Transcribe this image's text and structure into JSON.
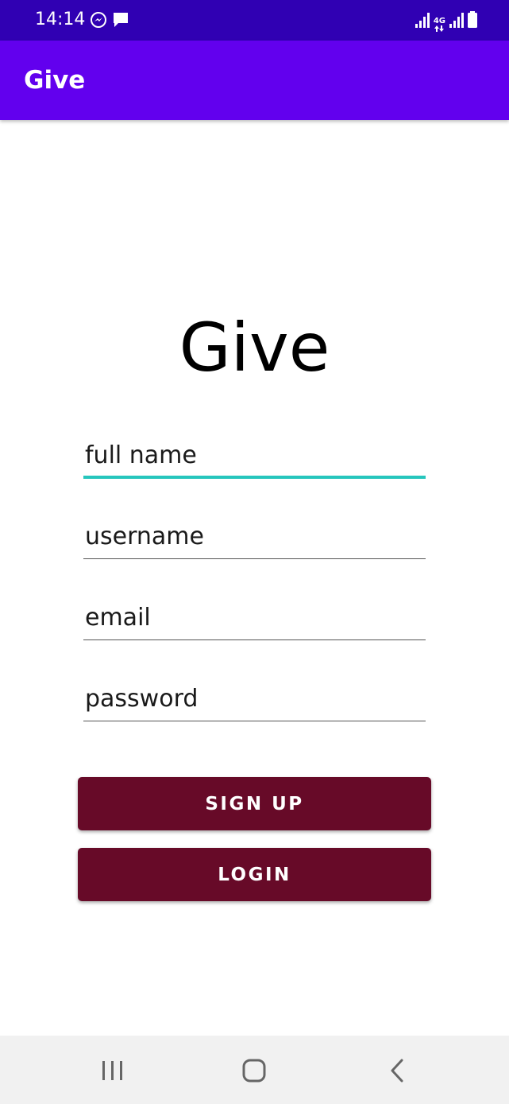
{
  "status_bar": {
    "time": "14:14",
    "network_type": "4G",
    "icons": [
      "messenger-icon",
      "message-icon",
      "signal-icon",
      "network-4g-icon",
      "signal-icon",
      "battery-icon"
    ],
    "background": "#3000b3"
  },
  "app_bar": {
    "title": "Give",
    "background": "#6200ee"
  },
  "main": {
    "hero_title": "Give",
    "fields": {
      "full_name": {
        "placeholder": "full name",
        "value": ""
      },
      "username": {
        "placeholder": "username",
        "value": ""
      },
      "email": {
        "placeholder": "email",
        "value": ""
      },
      "password": {
        "placeholder": "password",
        "value": ""
      }
    },
    "focus_color": "#26c6bd",
    "signup_label": "SIGN UP",
    "login_label": "LOGIN",
    "button_color": "#670a28"
  },
  "nav_bar": {
    "icons": [
      "recent-apps-icon",
      "home-icon",
      "back-icon"
    ]
  }
}
